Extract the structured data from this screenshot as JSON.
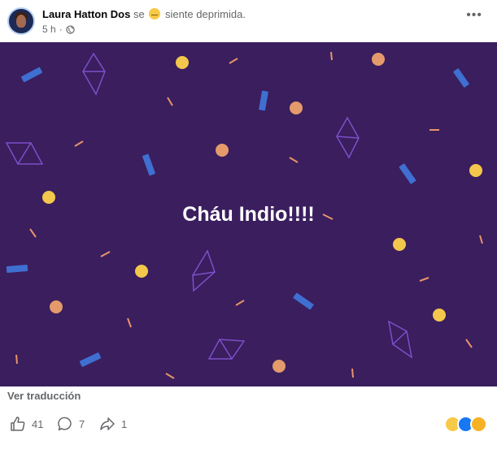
{
  "post": {
    "author": "Laura Hatton Dos",
    "feeling_prefix": "se",
    "feeling_text": "siente deprimida.",
    "time": "5 h",
    "separator": "·",
    "more_label": "•••",
    "banner_text": "Cháu Indio!!!!",
    "translate_label": "Ver traducción"
  },
  "actions": {
    "likes": "41",
    "comments": "7",
    "shares": "1"
  },
  "colors": {
    "banner_bg": "#3a1e5e",
    "confetti_blue": "#3f6fd1",
    "confetti_outline": "#7d4fc9",
    "dot_yellow": "#f3c74b",
    "dot_peach": "#e49a6b",
    "dash": "#e8946a"
  },
  "icons": [
    "globe-icon",
    "more-icon",
    "like-icon",
    "comment-icon",
    "share-icon",
    "sad-reaction-icon",
    "like-reaction-icon",
    "care-reaction-icon"
  ]
}
